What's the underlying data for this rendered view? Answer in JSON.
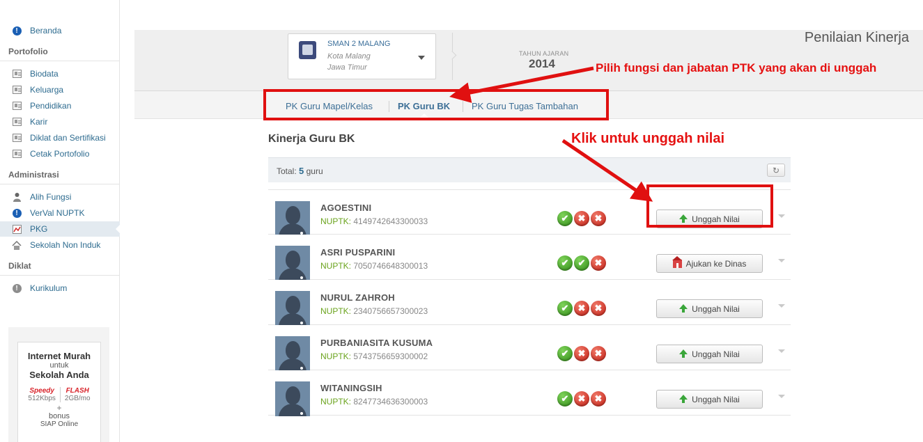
{
  "sidebar": {
    "home": "Beranda",
    "sections": [
      {
        "title": "Portofolio",
        "items": [
          "Biodata",
          "Keluarga",
          "Pendidikan",
          "Karir",
          "Diklat dan Sertifikasi",
          "Cetak Portofolio"
        ]
      },
      {
        "title": "Administrasi",
        "items": [
          "Alih Fungsi",
          "VerVal NUPTK",
          "PKG",
          "Sekolah Non Induk"
        ]
      },
      {
        "title": "Diklat",
        "items": [
          "Kurikulum"
        ]
      }
    ],
    "active_item": "PKG"
  },
  "ad": {
    "line1": "Internet Murah",
    "line2": "untuk",
    "line3": "Sekolah Anda",
    "brand1": "Speedy",
    "brand1_speed": "512Kbps",
    "brand2": "FLASH",
    "brand2_quota": "2GB/mo",
    "plus": "+",
    "bonus": "bonus",
    "bonus_item": "SIAP Online"
  },
  "header": {
    "school_name": "SMAN 2 MALANG",
    "city": "Kota Malang",
    "province": "Jawa Timur",
    "year_label": "TAHUN AJARAN",
    "year": "2014",
    "page_title": "Penilaian Kinerja"
  },
  "tabs": [
    {
      "label": "PK Guru Mapel/Kelas",
      "active": false
    },
    {
      "label": "PK Guru BK",
      "active": true
    },
    {
      "label": "PK Guru Tugas Tambahan",
      "active": false
    }
  ],
  "content": {
    "title": "Kinerja Guru BK",
    "total_prefix": "Total:",
    "total_count": "5",
    "total_suffix": "guru",
    "refresh_icon": "refresh-icon",
    "nuptk_label": "NUPTK:"
  },
  "teachers": [
    {
      "name": "AGOESTINI",
      "nuptk": "4149742643300033",
      "status": [
        "ok",
        "no",
        "no"
      ],
      "action": "Unggah Nilai"
    },
    {
      "name": "ASRI PUSPARINI",
      "nuptk": "7050746648300013",
      "status": [
        "ok",
        "ok",
        "no"
      ],
      "action": "Ajukan ke Dinas"
    },
    {
      "name": "NURUL ZAHROH",
      "nuptk": "2340756657300023",
      "status": [
        "ok",
        "no",
        "no"
      ],
      "action": "Unggah Nilai"
    },
    {
      "name": "PURBANIASITA KUSUMA",
      "nuptk": "5743756659300002",
      "status": [
        "ok",
        "no",
        "no"
      ],
      "action": "Unggah Nilai"
    },
    {
      "name": "WITANINGSIH",
      "nuptk": "8247734636300003",
      "status": [
        "ok",
        "no",
        "no"
      ],
      "action": "Unggah Nilai"
    }
  ],
  "annotations": {
    "note1": "Pilih fungsi dan jabatan PTK yang akan di unggah",
    "note2": "Klik untuk unggah nilai",
    "color": "#e51111"
  }
}
